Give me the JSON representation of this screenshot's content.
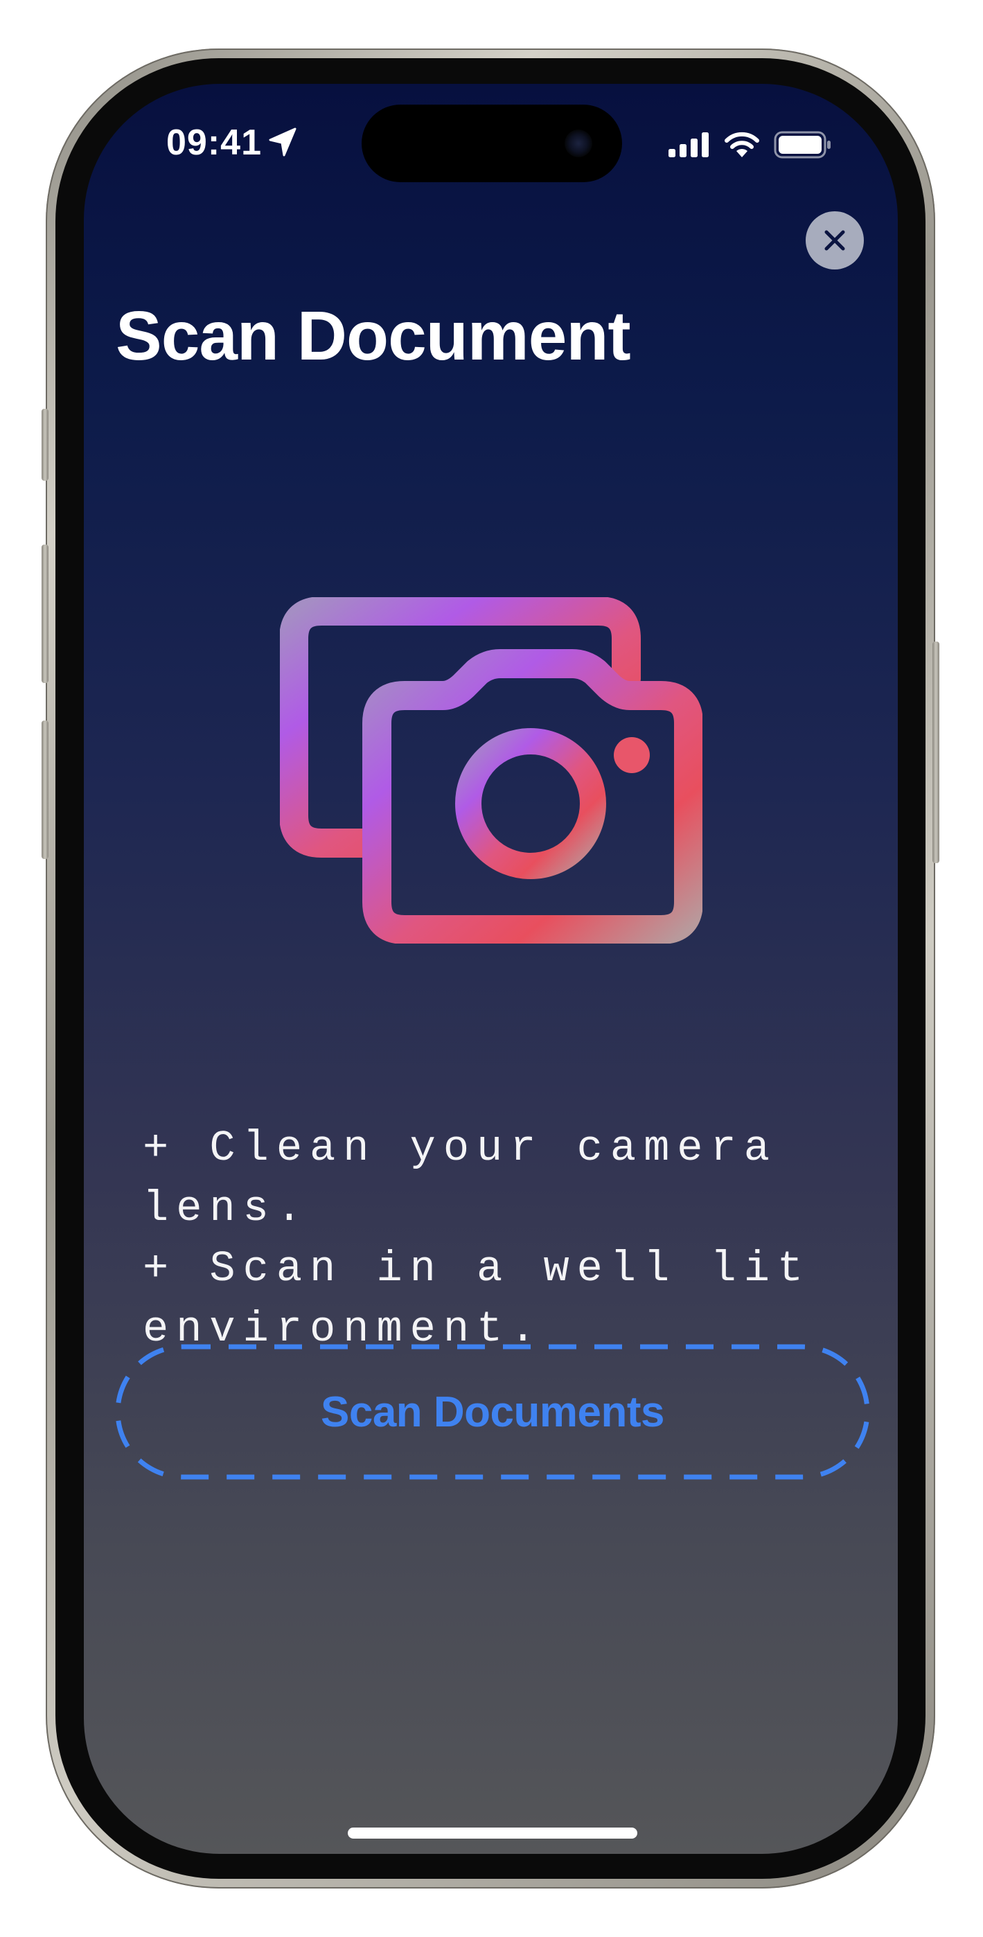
{
  "status_bar": {
    "time": "09:41",
    "location_icon": "location-arrow-icon",
    "signal_icon": "cellular-signal-icon",
    "wifi_icon": "wifi-icon",
    "battery_icon": "battery-icon"
  },
  "header": {
    "close_icon": "close-icon",
    "title": "Scan Document"
  },
  "hero": {
    "icon": "camera-photos-icon",
    "gradient_colors": [
      "#a58ec4",
      "#b05be6",
      "#e05680",
      "#e84f5e",
      "#b89a9c"
    ]
  },
  "tips": {
    "lines": [
      "+ Clean your camera lens.",
      "+ Scan in a well lit environment."
    ]
  },
  "actions": {
    "scan_button_label": "Scan Documents",
    "accent_color": "#3f82f0"
  }
}
